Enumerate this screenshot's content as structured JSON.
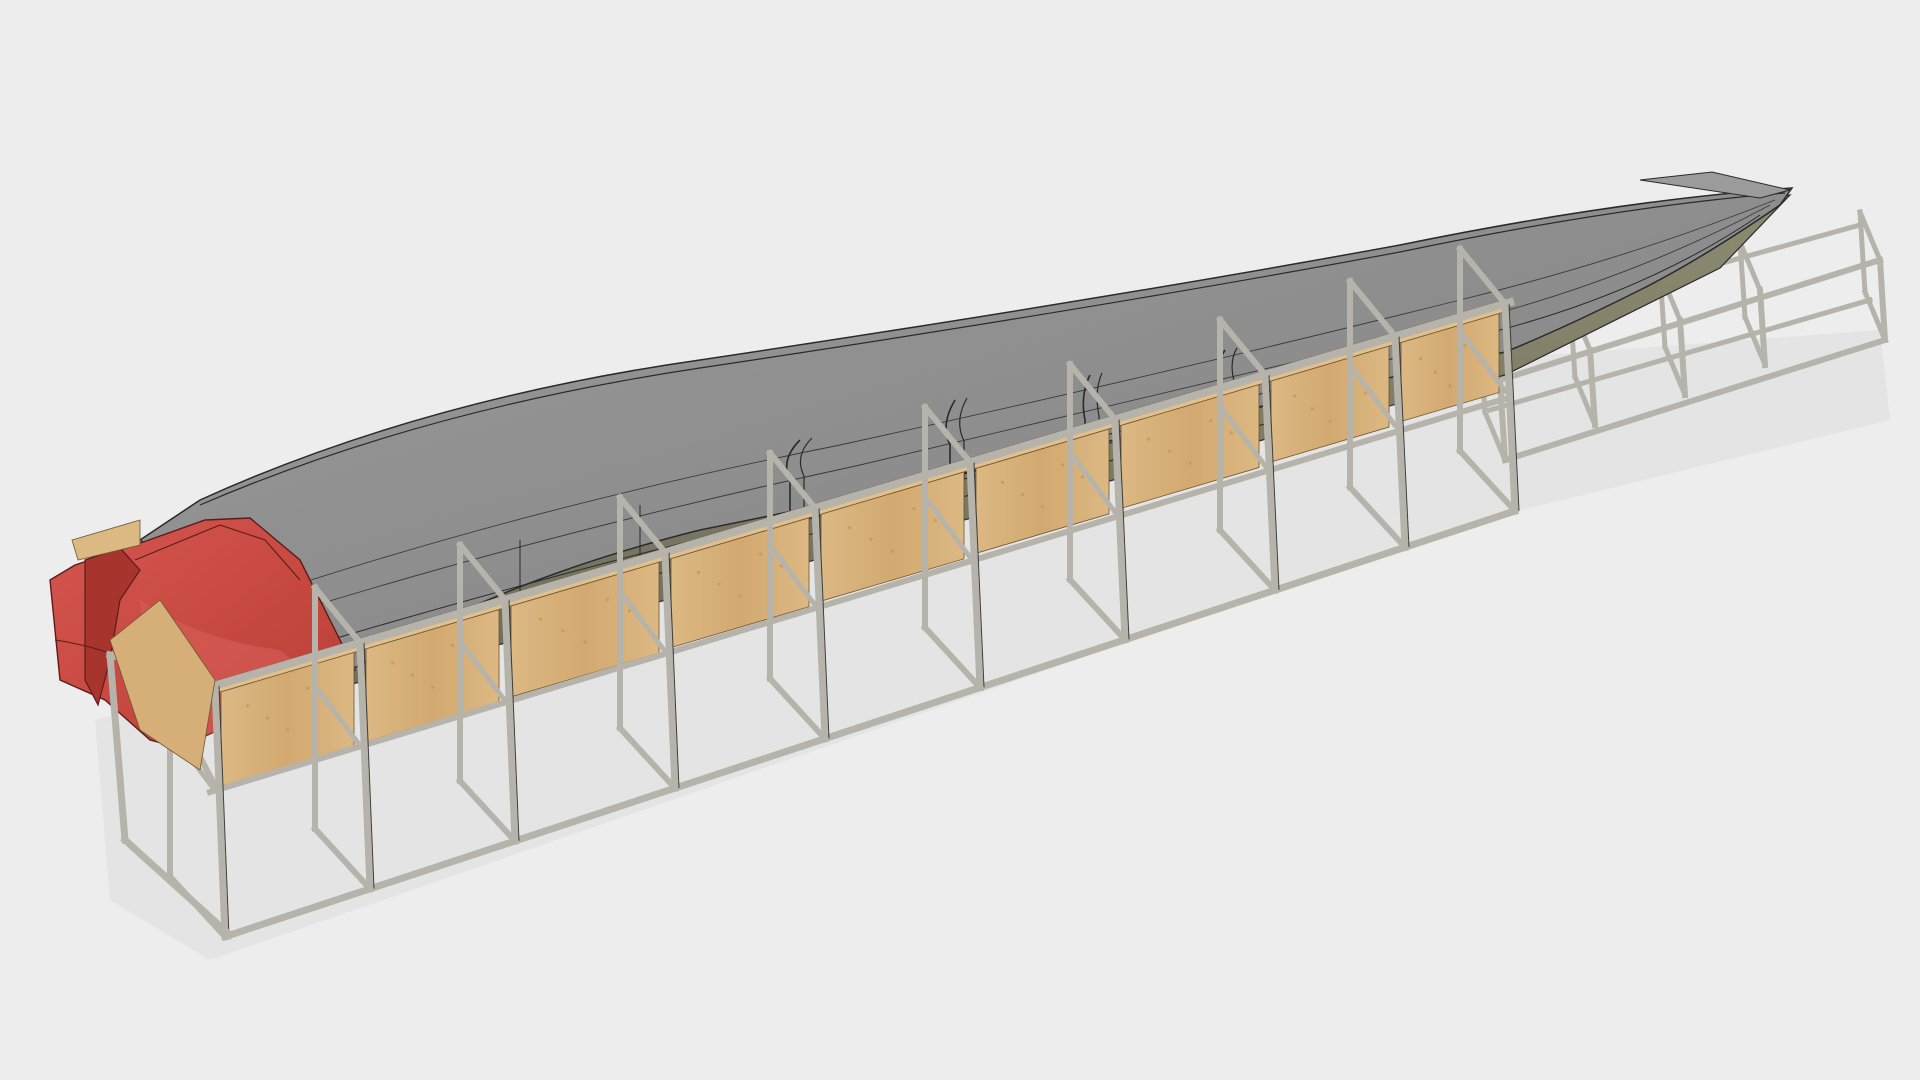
{
  "scene": {
    "background_color": "#ededed",
    "shadow_color": "#dadada",
    "hull_mould": {
      "main_color": "#8b8b8b",
      "inner_color": "#7e7e7e",
      "outer_color": "#7a7a6c",
      "rim_color": "#a6a6a6",
      "edge_color": "#2a2a2a"
    },
    "transom_plug": {
      "color": "#c94a42",
      "shade_color": "#a8342e",
      "highlight_color": "#d9605a"
    },
    "frame": {
      "tube_color": "#b6b3ab",
      "tube_edge_color": "#3d3d3d",
      "plywood_color": "#d8b27d",
      "plywood_grain_color": "#c79c63",
      "plywood_edge_color": "#6f5532"
    }
  }
}
